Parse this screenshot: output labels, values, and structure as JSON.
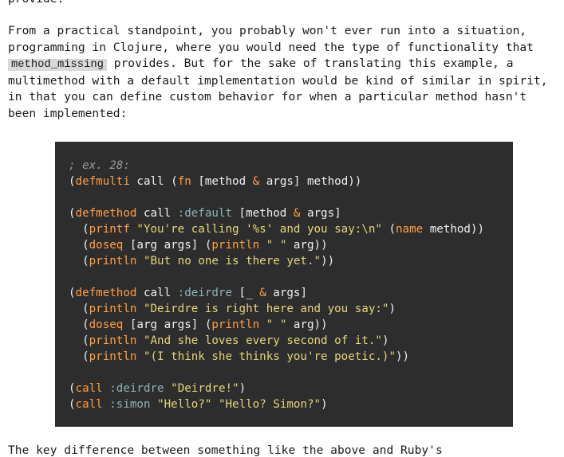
{
  "article": {
    "paragraph_top_tail": "provide.",
    "paragraph_1_before_code": "From a practical standpoint, you probably won't ever run into a situation, programming in Clojure, where you would need the type of functionality that ",
    "paragraph_1_inline_code": "method_missing",
    "paragraph_1_after_code": " provides. But for the sake of translating this example, a multimethod with a default implementation would be kind of similar in spirit, in that you can define custom behavior for when a particular method hasn't been implemented:",
    "paragraph_bottom": "The key difference between something like the above and Ruby's"
  },
  "code_block": {
    "language": "clojure",
    "colors": {
      "background": "#2d2d2d",
      "keyword": "#ff9f43",
      "string": "#e5d67a",
      "comment": "#9a9a9a",
      "keyword_literal": "#8fb3b8",
      "plain": "#f0f0f0"
    },
    "lines": [
      [
        {
          "t": "comment",
          "v": "; ex. 28:"
        }
      ],
      [
        {
          "t": "paren",
          "v": "("
        },
        {
          "t": "keyword",
          "v": "defmulti"
        },
        {
          "t": "plain",
          "v": " call ("
        },
        {
          "t": "keyword",
          "v": "fn"
        },
        {
          "t": "plain",
          "v": " [method "
        },
        {
          "t": "amp",
          "v": "&"
        },
        {
          "t": "plain",
          "v": " args] method))"
        }
      ],
      [],
      [
        {
          "t": "paren",
          "v": "("
        },
        {
          "t": "keyword",
          "v": "defmethod"
        },
        {
          "t": "plain",
          "v": " call "
        },
        {
          "t": "kw-literal",
          "v": ":default"
        },
        {
          "t": "plain",
          "v": " [method "
        },
        {
          "t": "amp",
          "v": "&"
        },
        {
          "t": "plain",
          "v": " args]"
        }
      ],
      [
        {
          "t": "plain",
          "v": "  ("
        },
        {
          "t": "keyword",
          "v": "printf"
        },
        {
          "t": "plain",
          "v": " "
        },
        {
          "t": "string",
          "v": "\"You're calling '%s' and you say:\\n\""
        },
        {
          "t": "plain",
          "v": " ("
        },
        {
          "t": "keyword",
          "v": "name"
        },
        {
          "t": "plain",
          "v": " method))"
        }
      ],
      [
        {
          "t": "plain",
          "v": "  ("
        },
        {
          "t": "keyword",
          "v": "doseq"
        },
        {
          "t": "plain",
          "v": " [arg args] ("
        },
        {
          "t": "keyword",
          "v": "println"
        },
        {
          "t": "plain",
          "v": " "
        },
        {
          "t": "string",
          "v": "\" \""
        },
        {
          "t": "plain",
          "v": " arg))"
        }
      ],
      [
        {
          "t": "plain",
          "v": "  ("
        },
        {
          "t": "keyword",
          "v": "println"
        },
        {
          "t": "plain",
          "v": " "
        },
        {
          "t": "string",
          "v": "\"But no one is there yet.\""
        },
        {
          "t": "plain",
          "v": "))"
        }
      ],
      [],
      [
        {
          "t": "paren",
          "v": "("
        },
        {
          "t": "keyword",
          "v": "defmethod"
        },
        {
          "t": "plain",
          "v": " call "
        },
        {
          "t": "kw-literal",
          "v": ":deirdre"
        },
        {
          "t": "plain",
          "v": " [_ "
        },
        {
          "t": "amp",
          "v": "&"
        },
        {
          "t": "plain",
          "v": " args]"
        }
      ],
      [
        {
          "t": "plain",
          "v": "  ("
        },
        {
          "t": "keyword",
          "v": "println"
        },
        {
          "t": "plain",
          "v": " "
        },
        {
          "t": "string",
          "v": "\"Deirdre is right here and you say:\""
        },
        {
          "t": "plain",
          "v": ")"
        }
      ],
      [
        {
          "t": "plain",
          "v": "  ("
        },
        {
          "t": "keyword",
          "v": "doseq"
        },
        {
          "t": "plain",
          "v": " [arg args] ("
        },
        {
          "t": "keyword",
          "v": "println"
        },
        {
          "t": "plain",
          "v": " "
        },
        {
          "t": "string",
          "v": "\" \""
        },
        {
          "t": "plain",
          "v": " arg))"
        }
      ],
      [
        {
          "t": "plain",
          "v": "  ("
        },
        {
          "t": "keyword",
          "v": "println"
        },
        {
          "t": "plain",
          "v": " "
        },
        {
          "t": "string",
          "v": "\"And she loves every second of it.\""
        },
        {
          "t": "plain",
          "v": ")"
        }
      ],
      [
        {
          "t": "plain",
          "v": "  ("
        },
        {
          "t": "keyword",
          "v": "println"
        },
        {
          "t": "plain",
          "v": " "
        },
        {
          "t": "string",
          "v": "\"(I think she thinks you're poetic.)\""
        },
        {
          "t": "plain",
          "v": "))"
        }
      ],
      [],
      [
        {
          "t": "paren",
          "v": "("
        },
        {
          "t": "keyword",
          "v": "call"
        },
        {
          "t": "plain",
          "v": " "
        },
        {
          "t": "kw-literal",
          "v": ":deirdre"
        },
        {
          "t": "plain",
          "v": " "
        },
        {
          "t": "string",
          "v": "\"Deirdre!\""
        },
        {
          "t": "plain",
          "v": ")"
        }
      ],
      [
        {
          "t": "paren",
          "v": "("
        },
        {
          "t": "keyword",
          "v": "call"
        },
        {
          "t": "plain",
          "v": " "
        },
        {
          "t": "kw-literal",
          "v": ":simon"
        },
        {
          "t": "plain",
          "v": " "
        },
        {
          "t": "string",
          "v": "\"Hello?\""
        },
        {
          "t": "plain",
          "v": " "
        },
        {
          "t": "string",
          "v": "\"Hello? Simon?\""
        },
        {
          "t": "plain",
          "v": ")"
        }
      ]
    ]
  }
}
